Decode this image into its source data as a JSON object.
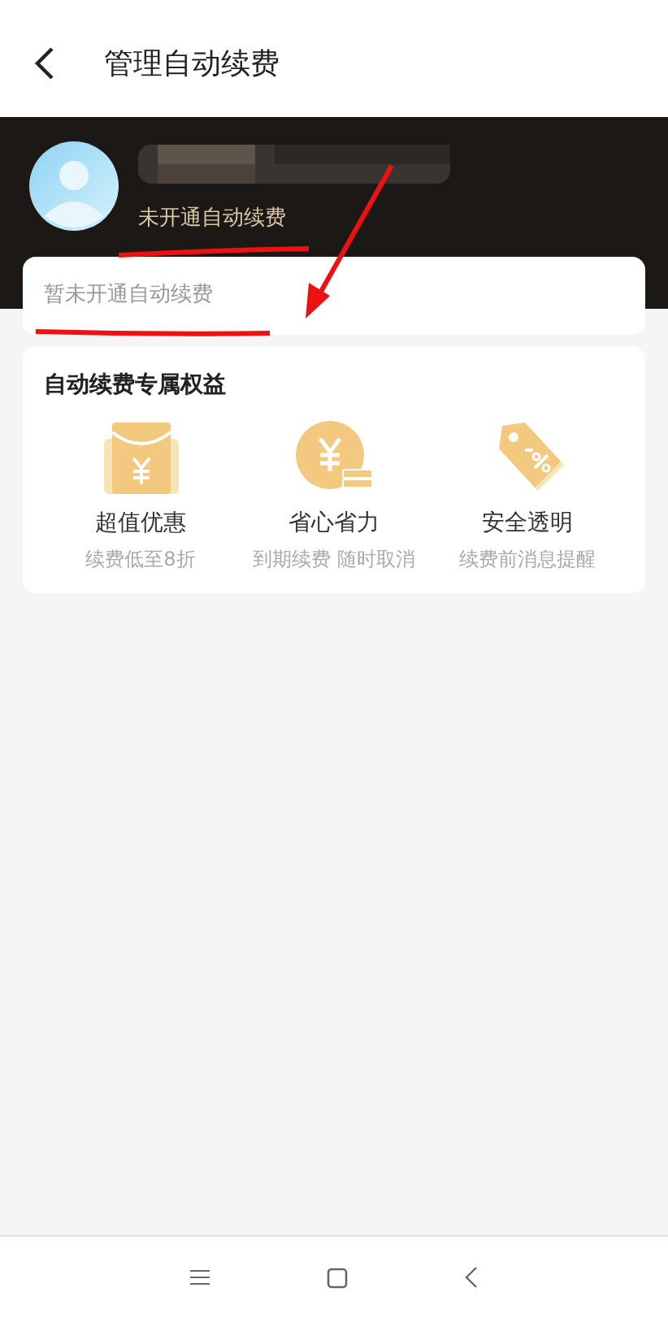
{
  "header": {
    "title": "管理自动续费"
  },
  "profile": {
    "status": "未开通自动续费"
  },
  "subscription_card": {
    "empty_text": "暂未开通自动续费"
  },
  "benefits": {
    "title": "自动续费专属权益",
    "items": [
      {
        "kind": "envelope",
        "title": "超值优惠",
        "subtitle": "续费低至8折"
      },
      {
        "kind": "coin",
        "title": "省心省力",
        "subtitle": "到期续费 随时取消"
      },
      {
        "kind": "tag",
        "title": "安全透明",
        "subtitle": "续费前消息提醒"
      }
    ]
  }
}
